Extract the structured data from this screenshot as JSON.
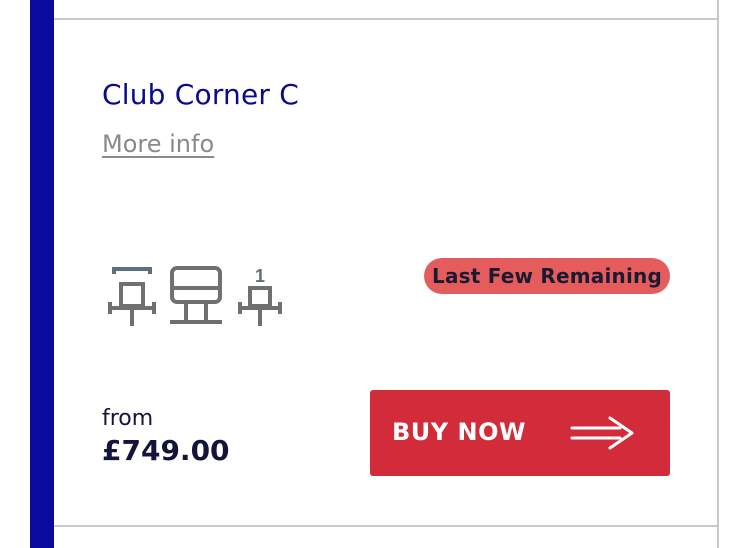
{
  "ticket": {
    "title": "Club Corner C",
    "more_info_label": "More info",
    "availability_badge": "Last Few Remaining",
    "price_prefix": "from",
    "price": "£749.00",
    "buy_label": "BUY NOW",
    "seat_count_label": "1"
  },
  "icons": {
    "seat_aisle": "aisle-seat-icon",
    "seat_standard": "seat-icon",
    "seat_single": "single-seat-icon",
    "arrow": "double-arrow-right-icon"
  },
  "colors": {
    "accent": "#0a0a9c",
    "title": "#0a0a8c",
    "badge_bg": "#e45c5c",
    "button_bg": "#d22b39",
    "icon_gray": "#707070",
    "icon_slate": "#5f6f7f"
  }
}
